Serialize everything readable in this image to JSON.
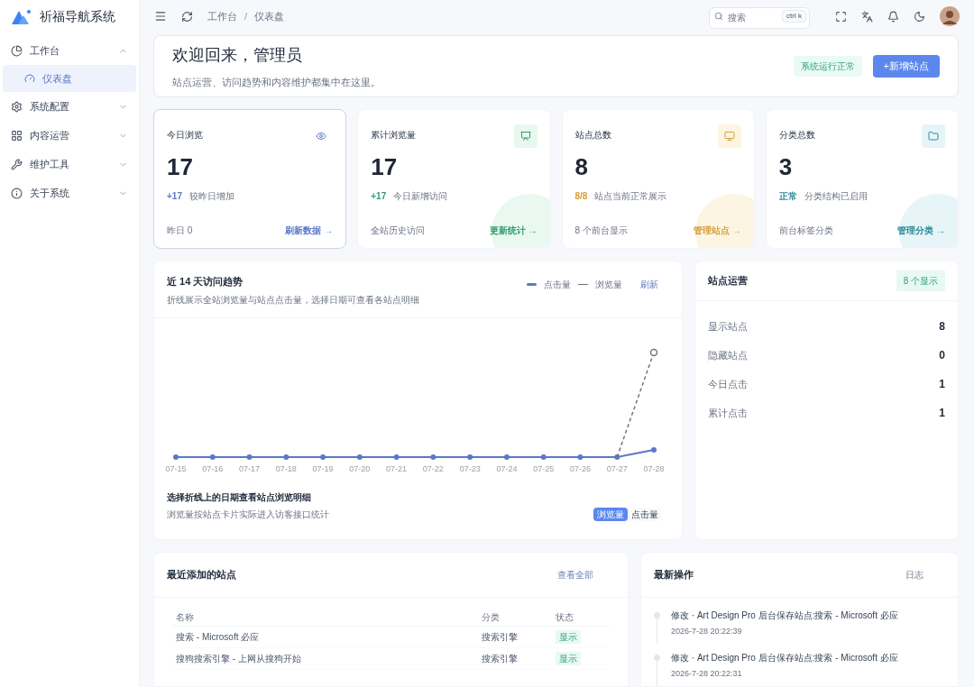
{
  "app": {
    "name": "祈福导航系统"
  },
  "sidebar": {
    "items": [
      {
        "label": "工作台",
        "expanded": true,
        "children": [
          {
            "label": "仪表盘",
            "selected": true
          }
        ]
      },
      {
        "label": "系统配置",
        "expanded": false
      },
      {
        "label": "内容运营",
        "expanded": false
      },
      {
        "label": "维护工具",
        "expanded": false
      },
      {
        "label": "关于系统",
        "expanded": false
      }
    ]
  },
  "header": {
    "breadcrumb": [
      "工作台",
      "仪表盘"
    ],
    "separator": "/",
    "search": {
      "placeholder": "搜索",
      "shortcut": "ctrl k"
    }
  },
  "welcome": {
    "title": "欢迎回来，管理员",
    "subtitle": "站点运营、访问趋势和内容维护都集中在这里。",
    "status": "系统运行正常",
    "button": "+新增站点"
  },
  "stats": [
    {
      "title": "今日浏览",
      "value": "17",
      "delta": "+17",
      "delta_text": "较昨日增加",
      "footer": "昨日 0",
      "link": "刷新数据 →",
      "color": "#5b78c7",
      "selected": true
    },
    {
      "title": "累计浏览量",
      "value": "17",
      "delta": "+17",
      "delta_text": "今日新增访问",
      "footer": "全站历史访问",
      "link": "更新统计 →",
      "color": "#2f9e6e",
      "selected": false
    },
    {
      "title": "站点总数",
      "value": "8",
      "delta": "8/8",
      "delta_text": "站点当前正常展示",
      "footer": "8 个前台显示",
      "link": "管理站点 →",
      "color": "#d4a03a",
      "selected": false
    },
    {
      "title": "分类总数",
      "value": "3",
      "delta": "正常",
      "delta_text": "分类结构已启用",
      "footer": "前台标签分类",
      "link": "管理分类 →",
      "color": "#2a8a96",
      "selected": false
    }
  ],
  "trend": {
    "title": "近 14 天访问趋势",
    "subtitle": "折线展示全站浏览量与站点点击量，选择日期可查看各站点明细",
    "legend": [
      "点击量",
      "浏览量"
    ],
    "refresh": "刷新",
    "x_labels": [
      "07-15",
      "07-16",
      "07-17",
      "07-18",
      "07-19",
      "07-20",
      "07-21",
      "07-22",
      "07-23",
      "07-24",
      "07-25",
      "07-26",
      "07-27",
      "07-28"
    ],
    "detail_title": "选择折线上的日期查看站点浏览明细",
    "detail_subtitle": "浏览量按站点卡片实际进入访客接口统计",
    "toggle": [
      {
        "label": "浏览量",
        "selected": true
      },
      {
        "label": "点击量",
        "selected": false
      }
    ]
  },
  "operations": {
    "title": "站点运营",
    "badge": "8 个显示",
    "rows": [
      {
        "label": "显示站点",
        "value": "8"
      },
      {
        "label": "隐藏站点",
        "value": "0"
      },
      {
        "label": "今日点击",
        "value": "1"
      },
      {
        "label": "累计点击",
        "value": "1"
      }
    ]
  },
  "recent_sites": {
    "title": "最近添加的站点",
    "link": "查看全部",
    "columns": [
      "名称",
      "分类",
      "状态"
    ],
    "rows": [
      {
        "name": "搜索 - Microsoft 必应",
        "category": "搜索引擎",
        "status": "显示"
      },
      {
        "name": "搜狗搜索引擎 - 上网从搜狗开始",
        "category": "搜索引擎",
        "status": "显示"
      }
    ]
  },
  "activity": {
    "title": "最新操作",
    "link": "日志",
    "items": [
      {
        "text": "修改 · Art Design Pro 后台保存站点:搜索 - Microsoft 必应",
        "time": "2026-7-28 20:22:39"
      },
      {
        "text": "修改 · Art Design Pro 后台保存站点:搜索 - Microsoft 必应",
        "time": "2026-7-28 20:22:31"
      }
    ]
  }
}
